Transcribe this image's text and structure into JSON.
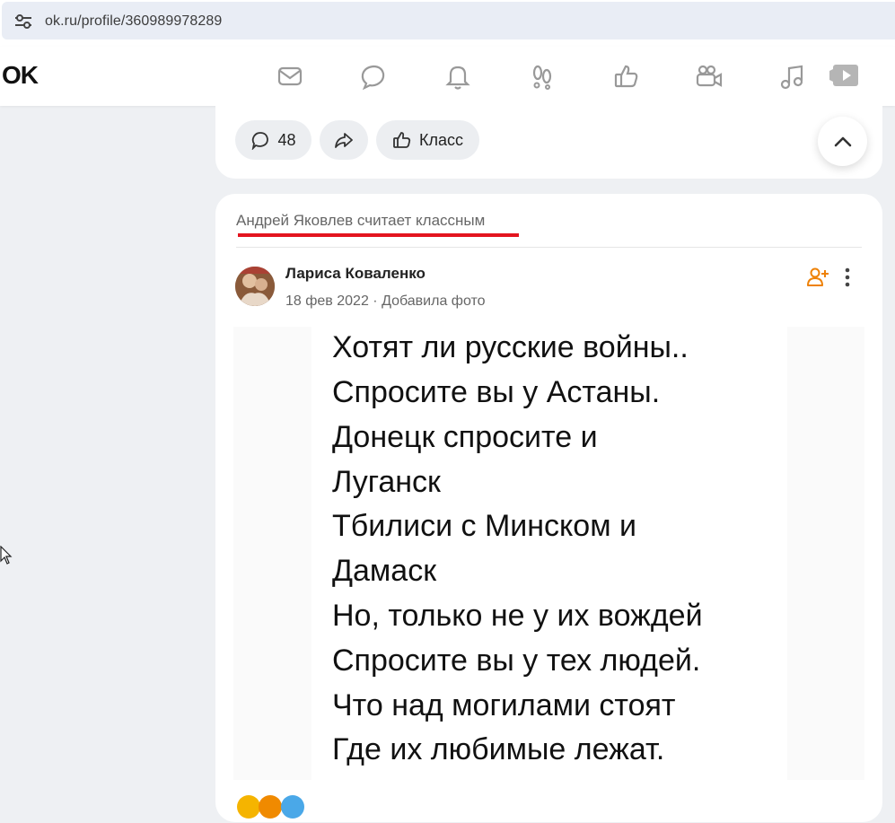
{
  "browser": {
    "url": "ok.ru/profile/360989978289",
    "tune_icon": "tune-icon"
  },
  "nav": {
    "logo": "OK",
    "icons": [
      "mail-icon",
      "chat-bubbles-icon",
      "bell-icon",
      "footprints-icon",
      "thumbs-up-icon",
      "video-camera-icon",
      "music-note-icon",
      "video-play-icon"
    ]
  },
  "prev_post": {
    "comments_count": "48",
    "class_label": "Класс"
  },
  "post": {
    "liker_text": "Андрей Яковлев считает классным",
    "author": "Лариса Коваленко",
    "meta": "18 фев 2022 · Добавила фото",
    "photo_lines": [
      "Хотят ли русские войны..",
      "Спросите  вы у Астаны.",
      "Донецк спросите и",
      "Луганск",
      "Тбилиси с Минском и",
      "Дамаск",
      "Но, только не у их вождей",
      "Спросите вы у тех людей.",
      "Что над могилами стоят",
      "Где их любимые лежат."
    ]
  },
  "colors": {
    "accent": "#ee8208",
    "underline": "#e3141f"
  }
}
